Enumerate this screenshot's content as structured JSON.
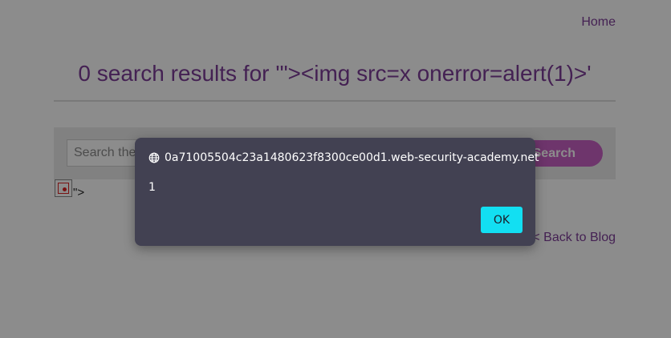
{
  "nav": {
    "home_label": "Home"
  },
  "page": {
    "title": "0 search results for '\"><img src=x onerror=alert(1)>'",
    "leftover_text": "\">",
    "back_label": "< Back to Blog"
  },
  "search": {
    "placeholder": "Search the blog...",
    "button_label": "Search"
  },
  "alert": {
    "origin": "0a71005504c23a1480623f8300ce00d1.web-security-academy.net",
    "message": "1",
    "ok_label": "OK",
    "icon": "globe-icon"
  },
  "colors": {
    "link": "#7d3c98",
    "button": "#c862c5",
    "dialog_bg": "#424152",
    "ok_button": "#12dff2"
  }
}
